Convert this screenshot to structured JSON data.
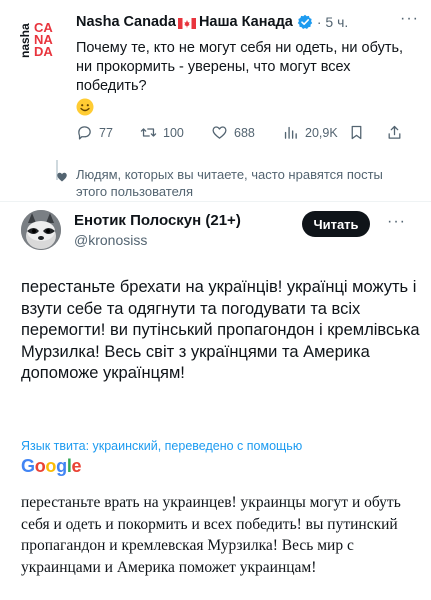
{
  "quoted": {
    "logo_text": "nasha CANADA",
    "display_name_en": "Nasha Canada",
    "display_name_ru": "Наша Канада",
    "time": "· 5 ч.",
    "text": "Почему те, кто не могут себя ни одеть, ни обуть, ни прокормить - уверены, что могут всех победить?",
    "emoji": "smiling-face",
    "actions": {
      "replies": "77",
      "retweets": "100",
      "likes": "688",
      "views": "20,9K"
    },
    "social_context": "Людям, которых вы читаете, часто нравятся посты этого пользователя"
  },
  "main": {
    "display_name": "Енотик Полоскун (21+)",
    "handle": "@kronosiss",
    "follow_label": "Читать",
    "text": "перестаньте брехати на українців!  українці можуть і взути себе та одягнути та погодувати та всіх перемогти!  ви путінський пропагондон і кремлівська Мурзилка!  Весь світ з українцями та Америка допоможе українцям!",
    "translation_note": "Язык твита: украинский, переведено с помощью",
    "translator": "Google",
    "translated_text": "перестаньте врать на украинцев! украинцы могут и обуть себя и одеть и покормить и всех победить! вы путинский пропагандон и кремлевская Мурзилка! Весь мир с украинцами и Америка поможет украинцам!"
  },
  "colors": {
    "accent": "#1d9bf0",
    "logo_red": "#e8343d",
    "button_bg": "#0f1419",
    "muted": "#536471"
  }
}
